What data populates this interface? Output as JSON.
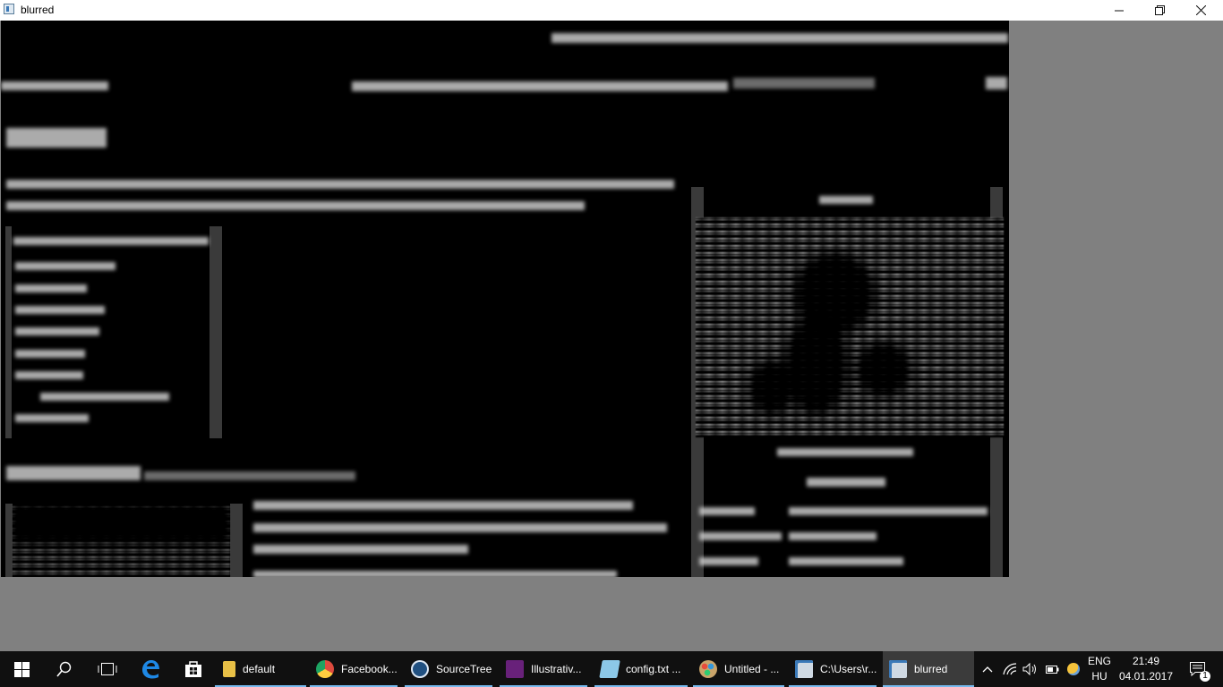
{
  "window": {
    "title": "blurred",
    "controls": {
      "minimize": "minimize",
      "maximize": "restore",
      "close": "close"
    }
  },
  "taskbar": {
    "pinned": [
      {
        "name": "start-button",
        "icon": "windows-logo-icon"
      },
      {
        "name": "search-button",
        "icon": "search-icon"
      },
      {
        "name": "task-view-button",
        "icon": "task-view-icon"
      },
      {
        "name": "edge-button",
        "icon": "edge-icon"
      },
      {
        "name": "store-button",
        "icon": "store-icon"
      }
    ],
    "items": [
      {
        "label": "default",
        "icon": "folder-icon",
        "color": "#e8c046"
      },
      {
        "label": "Facebook...",
        "icon": "chrome-icon",
        "color": "#dd4b3e"
      },
      {
        "label": "SourceTree",
        "icon": "sourcetree-icon",
        "color": "#205081"
      },
      {
        "label": "Illustrativ...",
        "icon": "visual-studio-icon",
        "color": "#68217a"
      },
      {
        "label": "config.txt ...",
        "icon": "notepad-icon",
        "color": "#8cc8e8"
      },
      {
        "label": "Untitled - ...",
        "icon": "paint-icon",
        "color": "#c9a46a"
      },
      {
        "label": "C:\\Users\\r...",
        "icon": "app-window-icon",
        "color": "#cfd9e3"
      },
      {
        "label": "blurred",
        "icon": "app-window-icon",
        "color": "#cfd9e3"
      }
    ],
    "tray": {
      "language_top": "ENG",
      "language_bottom": "HU",
      "time": "21:49",
      "date": "04.01.2017",
      "notification_count": "1"
    }
  }
}
